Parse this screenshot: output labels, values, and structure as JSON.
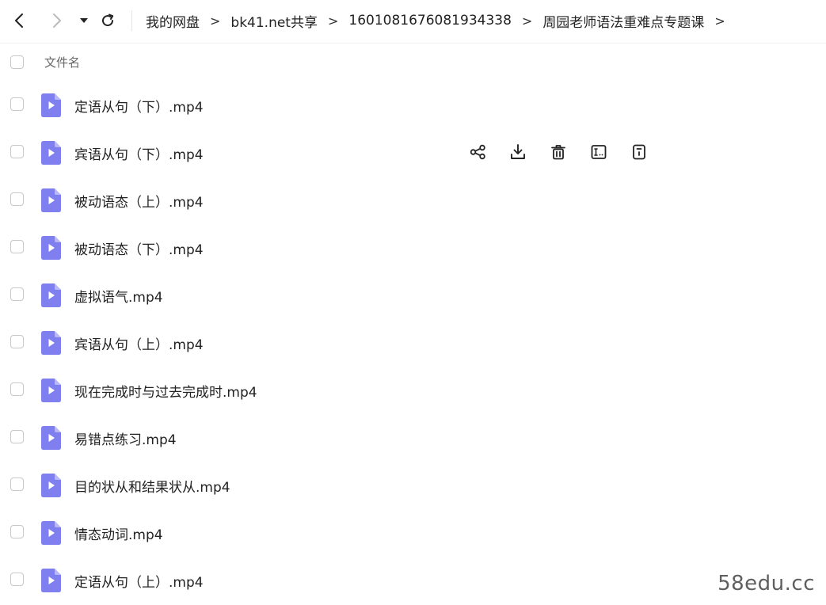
{
  "nav": {
    "back_icon": "chevron-left-icon",
    "forward_icon": "chevron-right-icon",
    "history_dropdown_icon": "caret-down-icon",
    "refresh_icon": "refresh-icon"
  },
  "breadcrumb": [
    "我的网盘",
    "bk41.net共享",
    "1601081676081934338",
    "周园老师语法重难点专题课"
  ],
  "breadcrumb_separator": ">",
  "list": {
    "header_label": "文件名",
    "files": [
      "定语从句（下）.mp4",
      "宾语从句（下）.mp4",
      "被动语态（上）.mp4",
      "被动语态（下）.mp4",
      "虚拟语气.mp4",
      "宾语从句（上）.mp4",
      "现在完成时与过去完成时.mp4",
      "易错点练习.mp4",
      "目的状从和结果状从.mp4",
      "情态动词.mp4",
      "定语从句（上）.mp4"
    ],
    "hovered_row_actions": [
      "share-icon",
      "download-icon",
      "delete-icon",
      "rename-icon",
      "details-icon"
    ]
  },
  "colors": {
    "file_icon": "#7f7ff0",
    "file_icon_fold": "#b9b9f7",
    "text": "#222222",
    "header_text": "#666666",
    "checkbox_border": "#c8c8cc"
  },
  "watermark": "58edu.cc"
}
